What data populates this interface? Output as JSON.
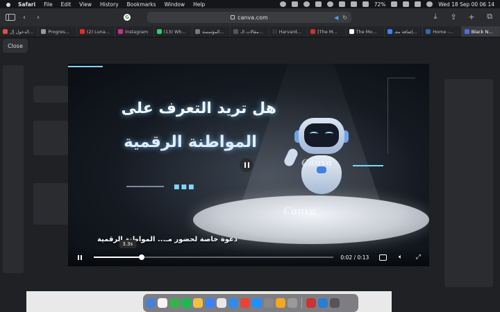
{
  "menubar": {
    "app_name": "Safari",
    "items": [
      "File",
      "Edit",
      "View",
      "History",
      "Bookmarks",
      "Window",
      "Help"
    ],
    "battery": "72%",
    "clock": "Wed 18 Sep  00 06 14"
  },
  "toolbar": {
    "url": "canva.com"
  },
  "tabs": [
    {
      "label": "الدخول إل...",
      "color": "#e74c3c"
    },
    {
      "label": "Progres...",
      "color": "#9a9a9a"
    },
    {
      "label": "(2) Luna...",
      "color": "#e52d27"
    },
    {
      "label": "Instagram",
      "color": "#c13584"
    },
    {
      "label": "(13) Wh...",
      "color": "#25d366"
    },
    {
      "label": "المؤسسة...",
      "color": "#777777"
    },
    {
      "label": "مقالات الـ...",
      "color": "#555555"
    },
    {
      "label": "Harvard...",
      "color": "#333333"
    },
    {
      "label": "[The M...",
      "color": "#c0392b"
    },
    {
      "label": "The Mo...",
      "color": "#ffffff"
    },
    {
      "label": "إضافة معـ...",
      "color": "#3b82f6"
    },
    {
      "label": "Home -...",
      "color": "#2b6cb0"
    },
    {
      "label": "Black N...",
      "color": "#4a6fe3",
      "active": true
    }
  ],
  "close_label": "Close",
  "video": {
    "title_line1": "هل تريد التعرف على",
    "title_line2": "المواطنة الرقمية",
    "subtitle": "دعوة خاصة لحضور مـ... المواطنة الرقمية",
    "watermark": "Canva",
    "tooltip": "3.3s",
    "current_time": "0:02",
    "duration": "0:13",
    "time_display": "0:02 / 0:13",
    "progress_fraction": 0.2
  },
  "dock": {
    "apps": [
      "#4a7fd4",
      "#f5f5f5",
      "#36b24a",
      "#1db954",
      "#f0c040",
      "#3b82f6",
      "#e8e8e8",
      "#2d8cf0",
      "#ea4335",
      "#1e90ff",
      "#888888",
      "#f5a623",
      "#9a9a9a",
      "#cc3333",
      "#2b7cd3",
      "#555555"
    ]
  }
}
